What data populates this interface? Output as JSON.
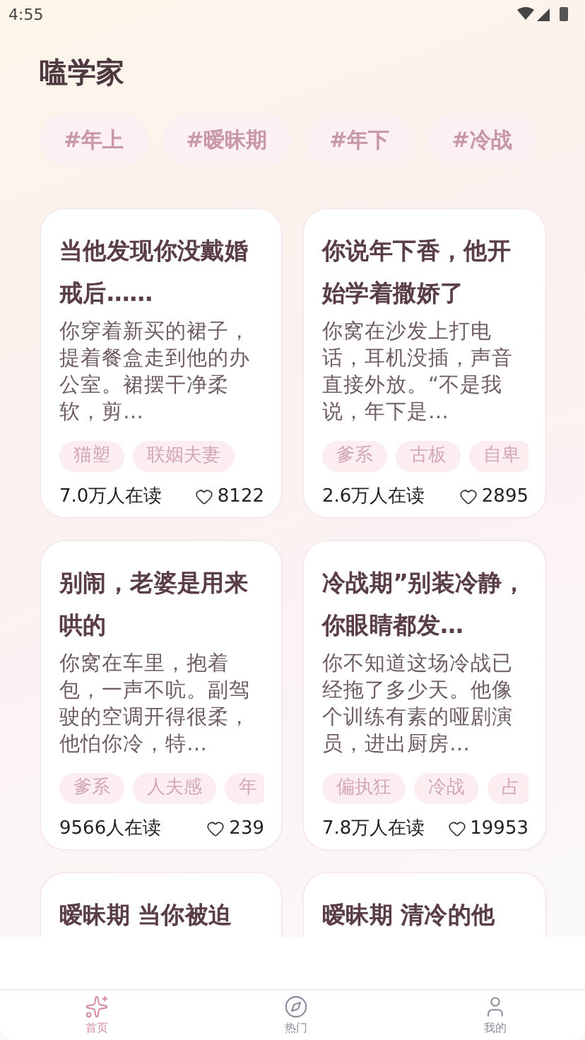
{
  "status_bar": {
    "time": "4:55"
  },
  "app_title": "嗑学家",
  "topic_chips": [
    "#年上",
    "#暧昧期",
    "#年下",
    "#冷战"
  ],
  "stories": [
    {
      "title": "当他发现你没戴婚戒后……",
      "excerpt": "你穿着新买的裙子，提着餐盒走到他的办公室。裙摆干净柔软，剪…",
      "tags": [
        "猫塑",
        "联姻夫妻"
      ],
      "readers": "7.0万人在读",
      "likes": "8122"
    },
    {
      "title": "你说年下香，他开始学着撒娇了",
      "excerpt": "你窝在沙发上打电话，耳机没插，声音直接外放。“不是我说，年下是…",
      "tags": [
        "爹系",
        "古板",
        "自卑"
      ],
      "readers": "2.6万人在读",
      "likes": "2895"
    },
    {
      "title": "别闹，老婆是用来哄的",
      "excerpt": "你窝在车里，抱着包，一声不吭。副驾驶的空调开得很柔，他怕你冷，特…",
      "tags": [
        "爹系",
        "人夫感",
        "年"
      ],
      "readers": "9566人在读",
      "likes": "239"
    },
    {
      "title": "冷战期”别装冷静，你眼睛都发…",
      "excerpt": "你不知道这场冷战已经拖了多少天。他像个训练有素的哑剧演员，进出厨房…",
      "tags": [
        "偏执狂",
        "冷战",
        "占"
      ],
      "readers": "7.8万人在读",
      "likes": "19953"
    },
    {
      "title": "暧昧期 当你被迫"
    },
    {
      "title": "暧昧期 清冷的他"
    }
  ],
  "bottom_nav": [
    {
      "kind": "sparkles",
      "label": "首页",
      "selected": true
    },
    {
      "kind": "compass",
      "label": "热门",
      "selected": false
    },
    {
      "kind": "user",
      "label": "我的",
      "selected": false
    }
  ]
}
